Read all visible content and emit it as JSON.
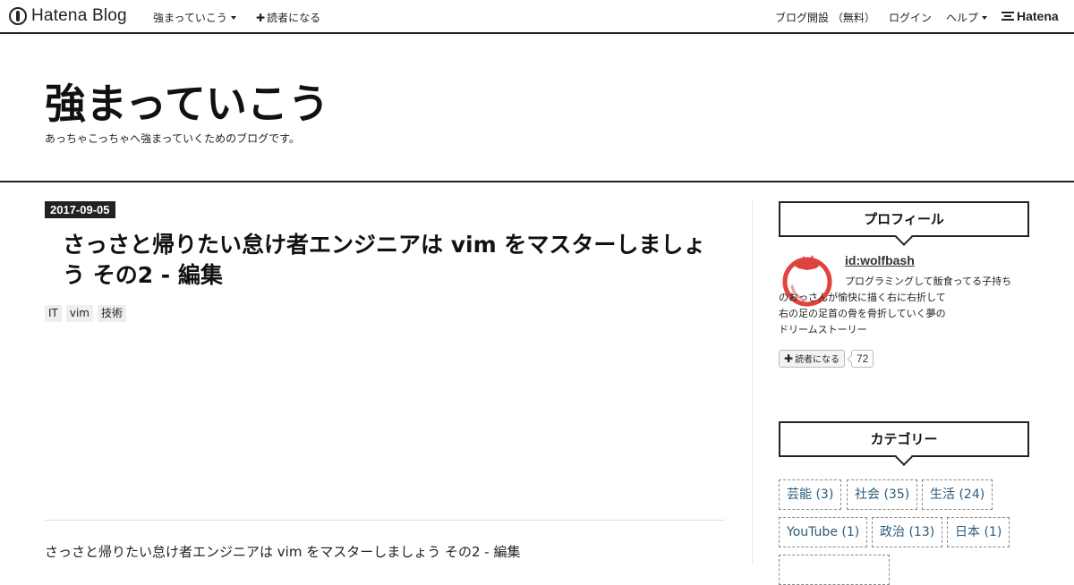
{
  "topbar": {
    "logo_text": "Hatena Blog",
    "blog_menu": "強まっていこう",
    "subscribe": "読者になる",
    "open_blog": "ブログ開設 （無料）",
    "login": "ログイン",
    "help": "ヘルプ",
    "hatena": "Hatena"
  },
  "header": {
    "title": "強まっていこう",
    "description": "あっちゃこっちゃへ強まっていくためのブログです。"
  },
  "entry": {
    "date": "2017-09-05",
    "title": "さっさと帰りたい怠け者エンジニアは vim をマスターしましょう その2 - 編集",
    "tags": [
      "IT",
      "vim",
      "技術"
    ],
    "summary": "さっさと帰りたい怠け者エンジニアは vim をマスターしましょう その2 - 編集"
  },
  "sidebar": {
    "profile_title": "プロフィール",
    "profile_id": "id:wolfbash",
    "profile_desc_1": "プログラミングして飯食ってる子持ち",
    "profile_desc_2": "のおっさんが愉快に描く右に右折して",
    "profile_desc_3": "右の足の足首の骨を骨折していく夢の",
    "profile_desc_4": "ドリームストーリー",
    "subscribe_label": "読者になる",
    "subscriber_count": "72",
    "category_title": "カテゴリー",
    "categories": [
      "芸能 (3)",
      "社会 (35)",
      "生活 (24)",
      "YouTube (1)",
      "政治 (13)",
      "日本 (1)"
    ]
  },
  "colors": {
    "accent": "#222222",
    "link": "#2b5a7b",
    "avatar": "#e0433f"
  },
  "icons": {
    "logo": "hatena-blog-pen-icon",
    "avatar": "tomato-icon"
  }
}
